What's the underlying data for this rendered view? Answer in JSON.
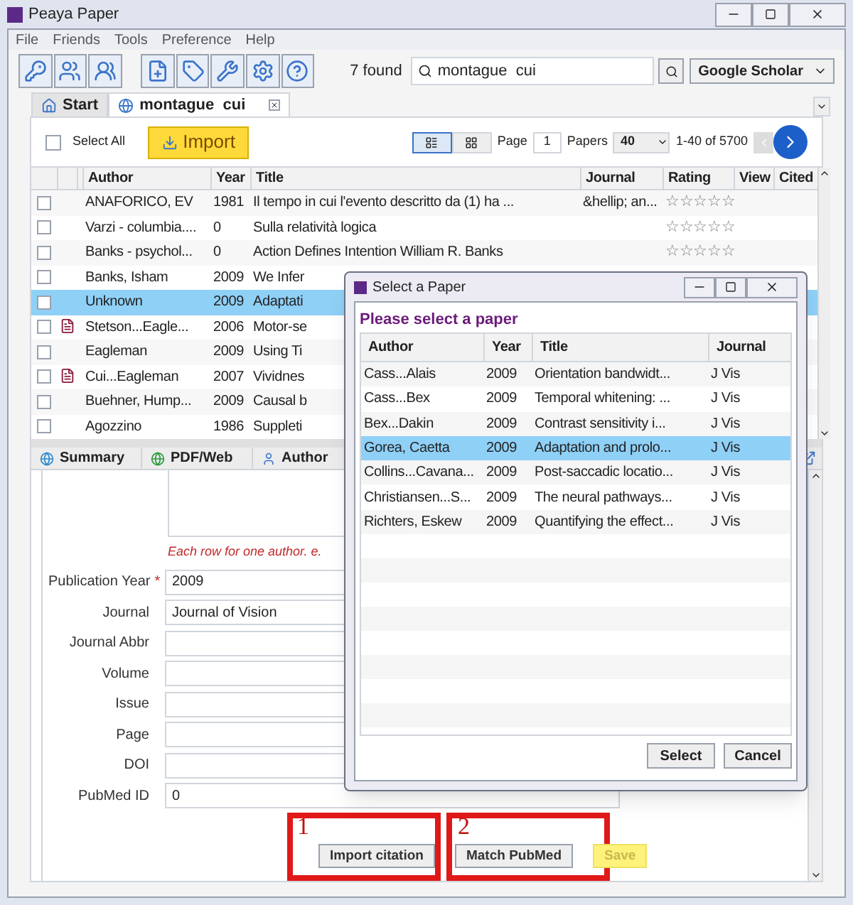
{
  "window": {
    "title": "Peaya Paper"
  },
  "menu": [
    "File",
    "Friends",
    "Tools",
    "Preference",
    "Help"
  ],
  "search": {
    "count": "7 found",
    "value": "montague  cui",
    "engine": "Google Scholar"
  },
  "tabs": [
    {
      "label": "Start",
      "selected": false,
      "closable": false
    },
    {
      "label": "montague  cui",
      "selected": true,
      "closable": true
    }
  ],
  "list_toolbar": {
    "select_all": "Select All",
    "select_all_checked": false,
    "import": "Import",
    "page_label": "Page",
    "page": "1",
    "papers_label": "Papers",
    "per_page": "40",
    "range": "1-40 of 5700"
  },
  "table": {
    "columns": [
      "Author",
      "Year",
      "Title",
      "Journal",
      "Rating",
      "View",
      "Cited"
    ],
    "rows": [
      {
        "author": "ANAFORICO, EV",
        "year": "1981",
        "title": "Il tempo in cui l'evento descritto da (1) ha ...",
        "journal": "&hellip; an...",
        "stars": 0,
        "pdf": false,
        "selected": false
      },
      {
        "author": "Varzi - columbia....",
        "year": "0",
        "title": "Sulla relatività logica",
        "stars": 0,
        "pdf": false,
        "selected": false
      },
      {
        "author": "Banks - psychol...",
        "year": "0",
        "title": "Action Defines Intention William R. Banks",
        "stars": 0,
        "pdf": false,
        "selected": false
      },
      {
        "author": "Banks, Isham",
        "year": "2009",
        "title": "We Infer",
        "pdf": false,
        "selected": false
      },
      {
        "author": "Unknown",
        "year": "2009",
        "title": "Adaptati",
        "pdf": false,
        "selected": true
      },
      {
        "author": "Stetson...Eagle...",
        "year": "2006",
        "title": "Motor-se",
        "pdf": true,
        "selected": false
      },
      {
        "author": "Eagleman",
        "year": "2009",
        "title": "Using Ti",
        "pdf": false,
        "selected": false
      },
      {
        "author": "Cui...Eagleman",
        "year": "2007",
        "title": "Vividnes",
        "pdf": true,
        "selected": false
      },
      {
        "author": "Buehner, Hump...",
        "year": "2009",
        "title": "Causal b",
        "pdf": false,
        "selected": false
      },
      {
        "author": "Agozzino",
        "year": "1986",
        "title": "Suppleti",
        "pdf": false,
        "selected": false
      }
    ]
  },
  "detail_tabs": [
    {
      "label": "Summary",
      "selected": false
    },
    {
      "label": "PDF/Web",
      "selected": false
    },
    {
      "label": "Author",
      "selected": false
    }
  ],
  "form": {
    "hint": "Each row for one author. e.",
    "required_mark": "*",
    "fields": [
      {
        "label": "Publication Year",
        "required": true,
        "value": "2009"
      },
      {
        "label": "Journal",
        "required": false,
        "value": "Journal of Vision"
      },
      {
        "label": "Journal Abbr",
        "required": false
      },
      {
        "label": "Volume",
        "required": false
      },
      {
        "label": "Issue",
        "required": false
      },
      {
        "label": "Page",
        "required": false
      },
      {
        "label": "DOI",
        "required": false
      },
      {
        "label": "PubMed ID",
        "required": false,
        "value": "0"
      }
    ]
  },
  "actions": [
    {
      "label": "Import citation",
      "disabled": false,
      "marker": "1"
    },
    {
      "label": "Match PubMed",
      "disabled": false,
      "marker": "2"
    },
    {
      "label": "Save",
      "disabled": true
    }
  ],
  "dialog": {
    "title": "Select a Paper",
    "heading": "Please select a paper",
    "columns": [
      "Author",
      "Year",
      "Title",
      "Journal"
    ],
    "rows": [
      {
        "author": "Cass...Alais",
        "year": "2009",
        "title": "Orientation bandwidt...",
        "journal": "J Vis",
        "selected": false
      },
      {
        "author": "Cass...Bex",
        "year": "2009",
        "title": "Temporal whitening: ...",
        "journal": "J Vis",
        "selected": false
      },
      {
        "author": "Bex...Dakin",
        "year": "2009",
        "title": "Contrast sensitivity i...",
        "journal": "J Vis",
        "selected": false
      },
      {
        "author": "Gorea, Caetta",
        "year": "2009",
        "title": "Adaptation and prolo...",
        "journal": "J Vis",
        "selected": true
      },
      {
        "author": "Collins...Cavana...",
        "year": "2009",
        "title": "Post-saccadic locatio...",
        "journal": "J Vis",
        "selected": false
      },
      {
        "author": "Christiansen...S...",
        "year": "2009",
        "title": "The neural pathways...",
        "journal": "J Vis",
        "selected": false
      },
      {
        "author": "Richters, Eskew",
        "year": "2009",
        "title": "Quantifying the effect...",
        "journal": "J Vis",
        "selected": false
      }
    ],
    "buttons": [
      "Select",
      "Cancel"
    ]
  }
}
